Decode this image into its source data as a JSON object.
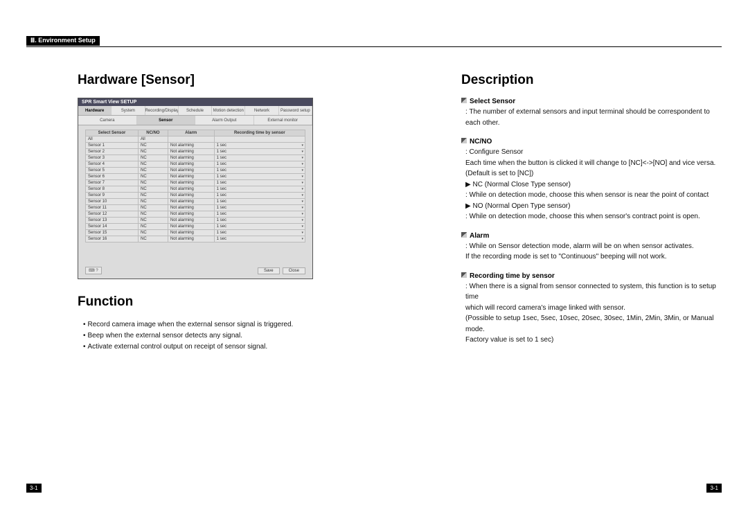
{
  "header": {
    "chapter_marker": "Ⅲ.",
    "chapter_title": "Environment Setup"
  },
  "left": {
    "heading_hardware": "Hardware [Sensor]",
    "heading_function": "Function",
    "function_bullets": [
      "Record camera image when the external sensor signal is triggered.",
      "Beep when the external sensor detects any signal.",
      "Activate external control output on receipt of sensor signal."
    ]
  },
  "screenshot": {
    "window_title": "SPR Smart View SETUP",
    "tabs": [
      "Hardware",
      "System",
      "Recording/Display",
      "Schedule",
      "Motion detection",
      "Network",
      "Password setup"
    ],
    "subtabs": [
      "Camera",
      "Sensor",
      "Alarm Output",
      "External monitor"
    ],
    "cols": [
      "Select Sensor",
      "NC/NO",
      "Alarm",
      "Recording time by sensor"
    ],
    "all_row": {
      "sensor": "All",
      "ncno": "All",
      "alarm": "",
      "rec": ""
    },
    "rows": [
      {
        "sensor": "Sensor 1",
        "ncno": "NC",
        "alarm": "Not alarming",
        "rec": "1 sec"
      },
      {
        "sensor": "Sensor 2",
        "ncno": "NC",
        "alarm": "Not alarming",
        "rec": "1 sec"
      },
      {
        "sensor": "Sensor 3",
        "ncno": "NC",
        "alarm": "Not alarming",
        "rec": "1 sec"
      },
      {
        "sensor": "Sensor 4",
        "ncno": "NC",
        "alarm": "Not alarming",
        "rec": "1 sec"
      },
      {
        "sensor": "Sensor 5",
        "ncno": "NC",
        "alarm": "Not alarming",
        "rec": "1 sec"
      },
      {
        "sensor": "Sensor 6",
        "ncno": "NC",
        "alarm": "Not alarming",
        "rec": "1 sec"
      },
      {
        "sensor": "Sensor 7",
        "ncno": "NC",
        "alarm": "Not alarming",
        "rec": "1 sec"
      },
      {
        "sensor": "Sensor 8",
        "ncno": "NC",
        "alarm": "Not alarming",
        "rec": "1 sec"
      },
      {
        "sensor": "Sensor 9",
        "ncno": "NC",
        "alarm": "Not alarming",
        "rec": "1 sec"
      },
      {
        "sensor": "Sensor 10",
        "ncno": "NC",
        "alarm": "Not alarming",
        "rec": "1 sec"
      },
      {
        "sensor": "Sensor 11",
        "ncno": "NC",
        "alarm": "Not alarming",
        "rec": "1 sec"
      },
      {
        "sensor": "Sensor 12",
        "ncno": "NC",
        "alarm": "Not alarming",
        "rec": "1 sec"
      },
      {
        "sensor": "Sensor 13",
        "ncno": "NC",
        "alarm": "Not alarming",
        "rec": "1 sec"
      },
      {
        "sensor": "Sensor 14",
        "ncno": "NC",
        "alarm": "Not alarming",
        "rec": "1 sec"
      },
      {
        "sensor": "Sensor 15",
        "ncno": "NC",
        "alarm": "Not alarming",
        "rec": "1 sec"
      },
      {
        "sensor": "Sensor 16",
        "ncno": "NC",
        "alarm": "Not alarming",
        "rec": "1 sec"
      }
    ],
    "btn_save": "Save",
    "btn_close": "Close",
    "help": "⌨ ?"
  },
  "right": {
    "heading": "Description",
    "items": [
      {
        "title": "Select Sensor",
        "lines": [
          ": The number of external sensors and input terminal should be correspondent to each other."
        ]
      },
      {
        "title": "NC/NO",
        "lines": [
          ": Configure Sensor",
          "Each time when the button is clicked it will change to [NC]<->[NO] and vice versa.",
          "(Default is set to [NC])",
          "▶ NC (Normal Close Type  sensor)",
          ": While on detection mode, choose this when sensor is near the point of contact",
          "▶ NO (Normal Open Type sensor)",
          ": While on detection mode, choose this when sensor's contract point is open."
        ]
      },
      {
        "title": "Alarm",
        "lines": [
          ": While on Sensor detection mode, alarm will be on when sensor activates.",
          "If the recording mode is set to \"Continuous\" beeping will not work."
        ]
      },
      {
        "title": "Recording time by sensor",
        "lines": [
          ": When there is a signal from sensor connected to system, this function is to setup time",
          "which will record camera's image linked with sensor.",
          "(Possible to setup 1sec, 5sec, 10sec, 20sec, 30sec, 1Min, 2Min, 3Min, or Manual mode.",
          "Factory value is set to 1 sec)"
        ]
      }
    ]
  },
  "page": {
    "left_num": "3-1",
    "right_num": "3-1"
  }
}
